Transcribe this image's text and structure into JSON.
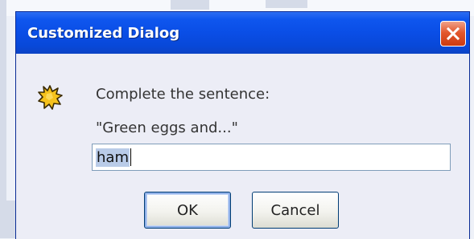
{
  "dialog": {
    "title": "Customized Dialog",
    "message_icon": "warning-burst-icon",
    "message_lines": [
      "Complete the sentence:",
      "\"Green eggs and...\""
    ],
    "input_value": "ham",
    "buttons": {
      "ok_label": "OK",
      "cancel_label": "Cancel"
    }
  },
  "colors": {
    "titlebar": "#0a4ee6",
    "close_button": "#e3582e",
    "dialog_body": "#ecedf6",
    "icon_fill": "#f6c21c"
  }
}
